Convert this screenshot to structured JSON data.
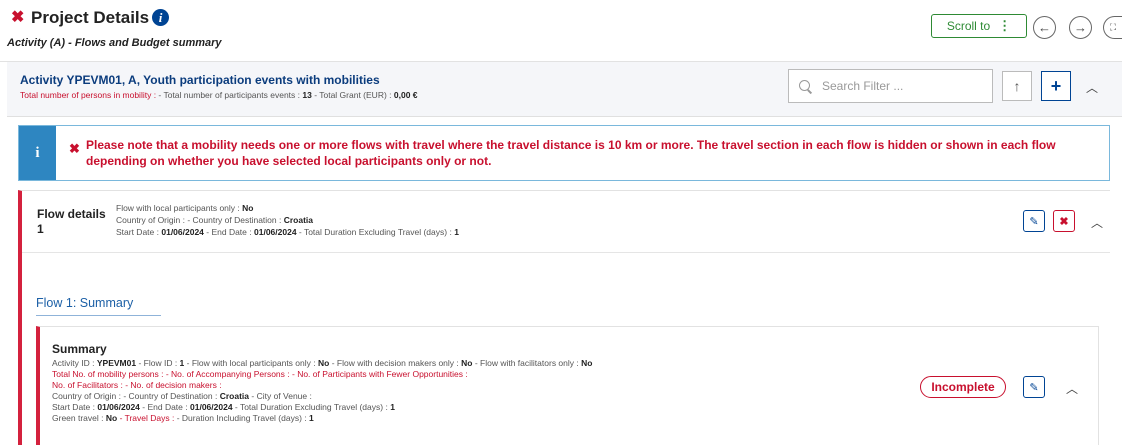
{
  "header": {
    "title": "Project Details",
    "subtitle": "Activity (A) - Flows and Budget summary",
    "scroll_to_label": "Scroll to"
  },
  "activity": {
    "title": "Activity YPEVM01, A, Youth participation events with mobilities",
    "stat_persons_label": "Total number of persons in mobility :",
    "stat_participants_label": " - Total number of participants events : ",
    "stat_participants_value": "13",
    "stat_grant_label": " - Total Grant (EUR) : ",
    "stat_grant_value": "0,00 €",
    "search_placeholder": "Search Filter ..."
  },
  "notice": {
    "text": "Please note that a mobility needs one or more flows with travel where the travel distance is 10 km or more. The travel section in each flow is hidden or shown in each flow depending on whether you have selected local participants only or not."
  },
  "flow": {
    "label": "Flow details 1",
    "local_label": "Flow with local participants only : ",
    "local_value": "No",
    "origin_label": "Country of Origin :  - Country of Destination : ",
    "destination_value": "Croatia",
    "start_label": "Start Date : ",
    "start_value": "01/06/2024",
    "end_label": " - End Date : ",
    "end_value": "01/06/2024",
    "duration_label": " - Total Duration Excluding Travel (days) : ",
    "duration_value": "1",
    "summary_link": "Flow 1: Summary"
  },
  "summary": {
    "title": "Summary",
    "activity_id_label": "Activity ID : ",
    "activity_id_value": "YPEVM01",
    "flow_id_label": " - Flow ID : ",
    "flow_id_value": "1",
    "local_label": " - Flow with local participants only : ",
    "local_value": "No",
    "decision_label": " - Flow with decision makers only : ",
    "decision_value": "No",
    "facilitators_only_label": " - Flow with facilitators only : ",
    "facilitators_only_value": "No",
    "line2": "Total No. of mobility persons :  - No. of Accompanying Persons :  - No. of Participants with Fewer Opportunities :",
    "line3": "No. of Facilitators :  - No. of decision makers :",
    "line4_label": "Country of Origin :  - Country of Destination : ",
    "line4_dest": "Croatia",
    "line4_venue": " - City of Venue :",
    "line5_start_label": "Start Date : ",
    "line5_start": "01/06/2024",
    "line5_end_label": " - End Date : ",
    "line5_end": "01/06/2024",
    "line5_dur_label": " - Total Duration Excluding Travel (days) : ",
    "line5_dur": "1",
    "line6_green_label": "Green travel : ",
    "line6_green": "No",
    "line6_days_label": " - Travel Days : ",
    "line6_incl_label": " - Duration Including Travel (days) : ",
    "line6_incl": "1",
    "status_badge": "Incomplete"
  },
  "colors": {
    "accent_red": "#c8102e",
    "primary_blue": "#004494",
    "info_blue": "#2e86c1",
    "green": "#2e8a34"
  }
}
